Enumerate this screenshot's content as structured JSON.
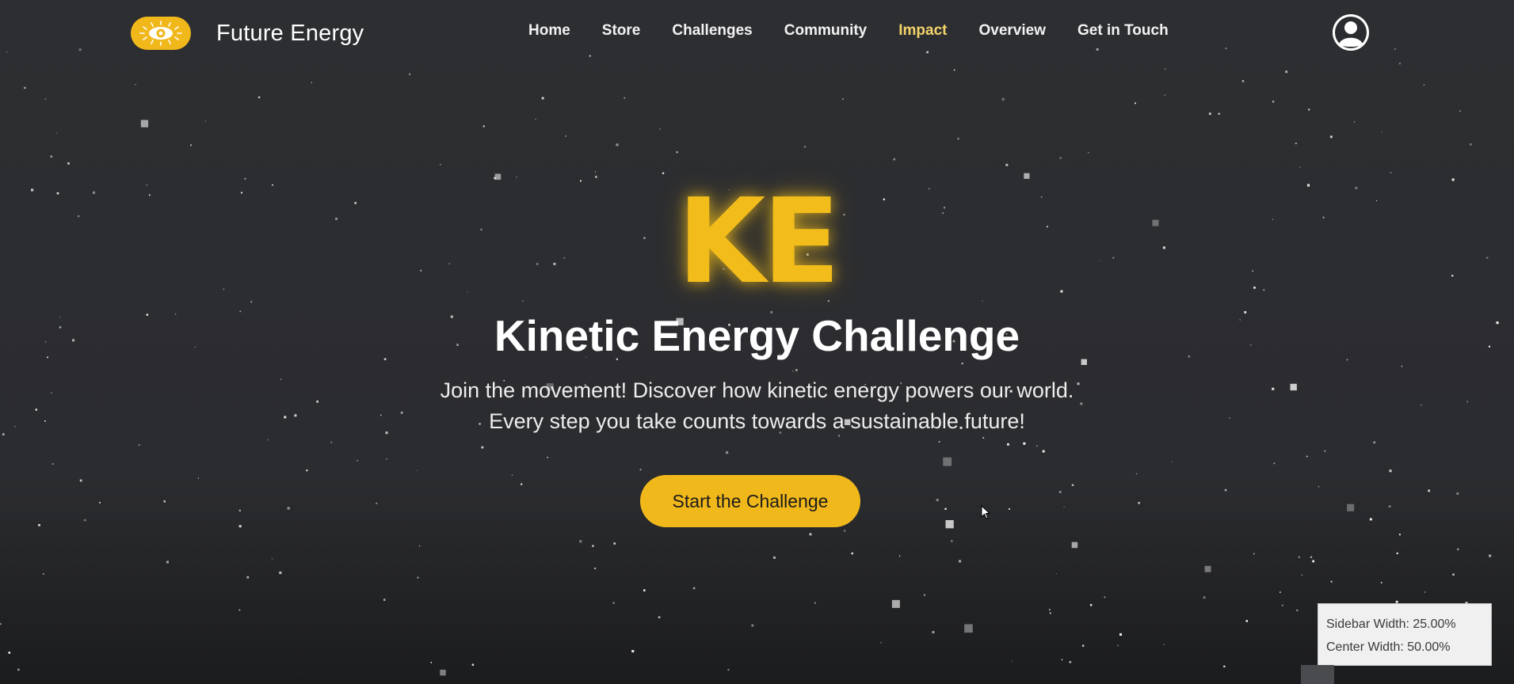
{
  "brand": {
    "name": "Future Energy",
    "logo_icon": "sun-eye-icon",
    "accent": "#f1b81b"
  },
  "nav": {
    "items": [
      {
        "label": "Home"
      },
      {
        "label": "Store"
      },
      {
        "label": "Challenges"
      },
      {
        "label": "Community"
      },
      {
        "label": "Impact"
      },
      {
        "label": "Overview"
      },
      {
        "label": "Get in Touch"
      }
    ],
    "active_index": 4,
    "active_color": "#f3d36b"
  },
  "user": {
    "avatar_icon": "user-avatar-icon"
  },
  "hero": {
    "mark": "KE",
    "title": "Kinetic Energy Challenge",
    "description": "Join the movement! Discover how kinetic energy powers our world. Every step you take counts towards a sustainable future!",
    "cta_label": "Start the Challenge"
  },
  "debug": {
    "sidebar_width": "Sidebar Width: 25.00%",
    "center_width": "Center Width: 50.00%"
  },
  "colors": {
    "background": "#2b2c2f",
    "text": "#ffffff",
    "cta": "#f1b81b"
  }
}
